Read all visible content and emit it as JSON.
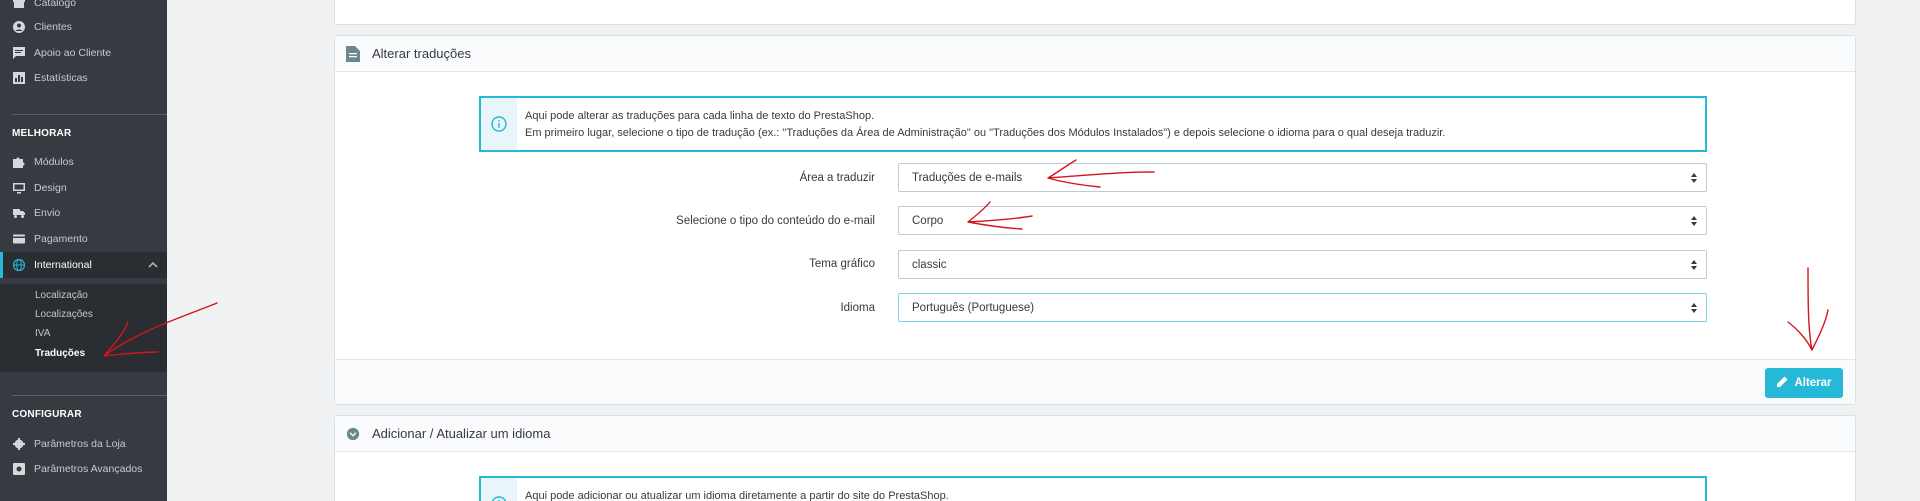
{
  "sidebar": {
    "items_top": [
      {
        "label": "Catálogo",
        "icon": "store-icon"
      },
      {
        "label": "Clientes",
        "icon": "user-icon"
      },
      {
        "label": "Apoio ao Cliente",
        "icon": "chat-icon"
      },
      {
        "label": "Estatísticas",
        "icon": "chart-icon"
      }
    ],
    "section_improve": "MELHORAR",
    "items_improve": [
      {
        "label": "Módulos",
        "icon": "puzzle-icon"
      },
      {
        "label": "Design",
        "icon": "monitor-icon"
      },
      {
        "label": "Envio",
        "icon": "truck-icon"
      },
      {
        "label": "Pagamento",
        "icon": "card-icon"
      },
      {
        "label": "International",
        "icon": "globe-icon"
      }
    ],
    "submenu": [
      "Localização",
      "Localizações",
      "IVA",
      "Traduções"
    ],
    "section_configure": "CONFIGURAR",
    "items_configure": [
      {
        "label": "Parâmetros da Loja",
        "icon": "gear-icon"
      },
      {
        "label": "Parâmetros Avançados",
        "icon": "gears-icon"
      }
    ]
  },
  "panel_modify": {
    "title": "Alterar traduções",
    "info_line1": "Aqui pode alterar as traduções para cada linha de texto do PrestaShop.",
    "info_line2": "Em primeiro lugar, selecione o tipo de tradução (ex.: \"Traduções da Área de Administração\" ou \"Traduções dos Módulos Instalados\") e depois selecione o idioma para o qual deseja traduzir.",
    "fields": [
      {
        "label": "Área a traduzir",
        "value": "Traduções de e-mails"
      },
      {
        "label": "Selecione o tipo do conteúdo do e-mail",
        "value": "Corpo"
      },
      {
        "label": "Tema gráfico",
        "value": "classic"
      },
      {
        "label": "Idioma",
        "value": "Português (Portuguese)"
      }
    ],
    "submit_label": "Alterar"
  },
  "panel_add": {
    "title": "Adicionar / Atualizar um idioma",
    "info_line1": "Aqui pode adicionar ou atualizar um idioma diretamente a partir do site do PrestaShop."
  },
  "colors": {
    "sidebar_bg": "#363a41",
    "accent": "#25b9d7",
    "annotation": "#d2161e"
  }
}
